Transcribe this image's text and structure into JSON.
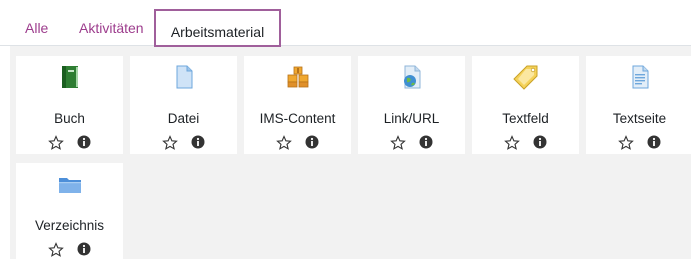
{
  "tabs": [
    {
      "label": "Alle",
      "active": false
    },
    {
      "label": "Aktivitäten",
      "active": false
    },
    {
      "label": "Arbeitsmaterial",
      "active": true
    }
  ],
  "items": [
    {
      "label": "Buch",
      "icon": "book-icon"
    },
    {
      "label": "Datei",
      "icon": "file-icon"
    },
    {
      "label": "IMS-Content",
      "icon": "ims-content-icon"
    },
    {
      "label": "Link/URL",
      "icon": "link-url-icon"
    },
    {
      "label": "Textfeld",
      "icon": "label-tag-icon"
    },
    {
      "label": "Textseite",
      "icon": "page-icon"
    },
    {
      "label": "Verzeichnis",
      "icon": "folder-icon"
    }
  ],
  "colors": {
    "tab_link": "#9d3d8d",
    "active_tab_border": "#a05f9b",
    "area_background": "#f2f2f2"
  }
}
